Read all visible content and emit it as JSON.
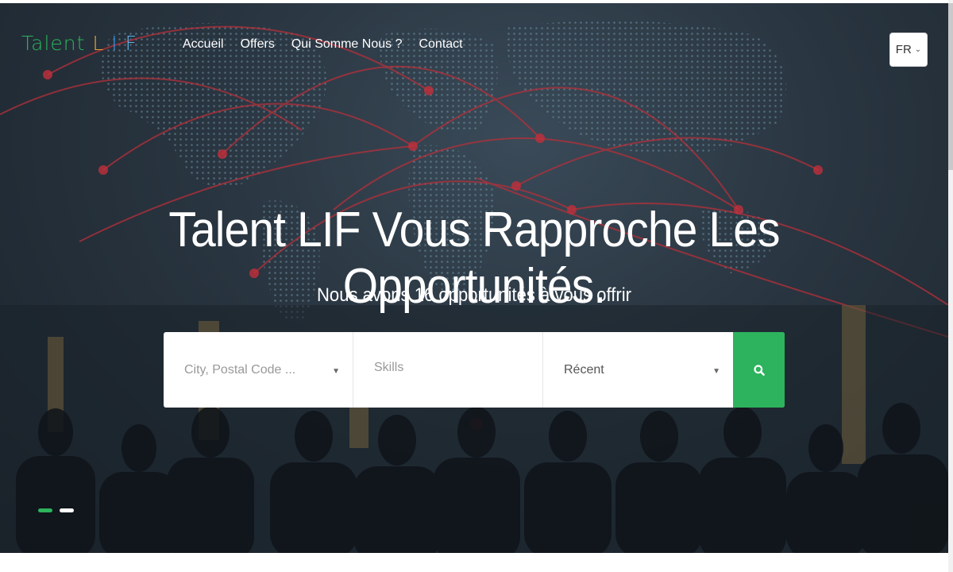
{
  "brand": {
    "part1": "Talent",
    "l": "L",
    "i": "I",
    "f": "F"
  },
  "nav": {
    "items": [
      {
        "label": "Accueil"
      },
      {
        "label": "Offers"
      },
      {
        "label": "Qui Somme Nous ?"
      },
      {
        "label": "Contact"
      }
    ],
    "language": "FR"
  },
  "hero": {
    "headline": "Talent LIF Vous Rapproche Les Opportunités.",
    "subline": "Nous avons 16 opportunités à vous offrir"
  },
  "search": {
    "location_placeholder": "City, Postal Code ...",
    "skills_placeholder": "Skills",
    "sort_value": "Récent",
    "button_icon": "search-icon"
  },
  "carousel": {
    "slide_count": 2,
    "active_index": 0
  },
  "colors": {
    "accent": "#2db35d",
    "logo_l": "#e8a22c",
    "logo_i": "#3a8fe0",
    "logo_f": "#5fb2e8",
    "hero_bg": "#28343f"
  }
}
